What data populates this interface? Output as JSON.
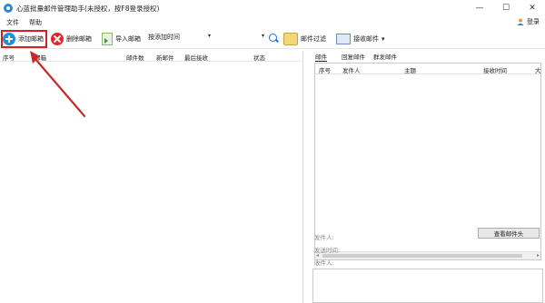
{
  "window": {
    "title": "心蓝批量邮件管理助手(未授权，按F8登录授权)",
    "minimize_glyph": "—",
    "maximize_glyph": "☐",
    "close_glyph": "✕"
  },
  "menu": {
    "file": "文件",
    "help": "帮助"
  },
  "login": {
    "label": "登录",
    "icon": "user-icon"
  },
  "toolbar": {
    "add_label": "添加邮箱",
    "delete_label": "删除邮箱",
    "import_label": "导入邮箱",
    "sort_label": "按添加时间",
    "filter_label": "邮件过滤",
    "receive_label": "接收邮件",
    "dropdown_glyph": "▾"
  },
  "accounts_table": {
    "columns": [
      "序号",
      "邮箱",
      "邮件数",
      "新邮件",
      "最后接收",
      "状态"
    ]
  },
  "mail_tabs": [
    "邮件",
    "回复邮件",
    "群发邮件"
  ],
  "mail_table": {
    "columns": [
      "序号",
      "发件人",
      "主题",
      "接收时间",
      "大"
    ]
  },
  "details": {
    "sender_label": "发件人:",
    "time_label": "发送时间:",
    "recipient_label": "收件人:",
    "view_header_button": "查看邮件头"
  },
  "colors": {
    "accent_blue": "#1e90d9",
    "delete_red": "#e2262a",
    "highlight_red": "#d32020"
  }
}
